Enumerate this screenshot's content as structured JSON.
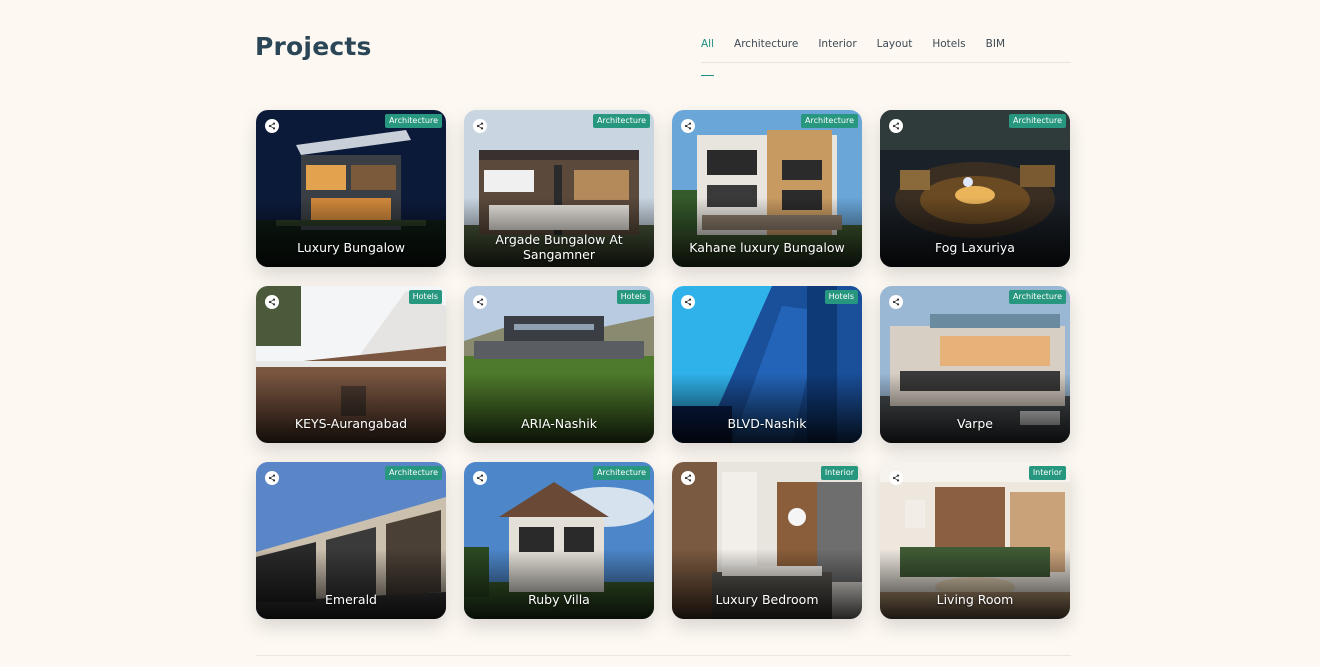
{
  "page": {
    "title": "Projects",
    "accent_color": "#27977f"
  },
  "tabs": [
    {
      "label": "All",
      "active": true
    },
    {
      "label": "Architecture",
      "active": false
    },
    {
      "label": "Interior",
      "active": false
    },
    {
      "label": "Layout",
      "active": false
    },
    {
      "label": "Hotels",
      "active": false
    },
    {
      "label": "BIM",
      "active": false
    }
  ],
  "projects": [
    {
      "title": "Luxury Bungalow",
      "category": "Architecture",
      "share_icon": "share-icon"
    },
    {
      "title": "Argade Bungalow At Sangamner",
      "category": "Architecture",
      "share_icon": "share-icon"
    },
    {
      "title": "Kahane luxury Bungalow",
      "category": "Architecture",
      "share_icon": "share-icon"
    },
    {
      "title": "Fog Laxuriya",
      "category": "Architecture",
      "share_icon": "share-icon"
    },
    {
      "title": "KEYS-Aurangabad",
      "category": "Hotels",
      "share_icon": "share-icon"
    },
    {
      "title": "ARIA-Nashik",
      "category": "Hotels",
      "share_icon": "share-icon"
    },
    {
      "title": "BLVD-Nashik",
      "category": "Hotels",
      "share_icon": "share-icon"
    },
    {
      "title": "Varpe",
      "category": "Architecture",
      "share_icon": "share-icon"
    },
    {
      "title": "Emerald",
      "category": "Architecture",
      "share_icon": "share-icon"
    },
    {
      "title": "Ruby Villa",
      "category": "Architecture",
      "share_icon": "share-icon"
    },
    {
      "title": "Luxury Bedroom",
      "category": "Interior",
      "share_icon": "share-icon"
    },
    {
      "title": "Living Room",
      "category": "Interior",
      "share_icon": "share-icon"
    }
  ]
}
